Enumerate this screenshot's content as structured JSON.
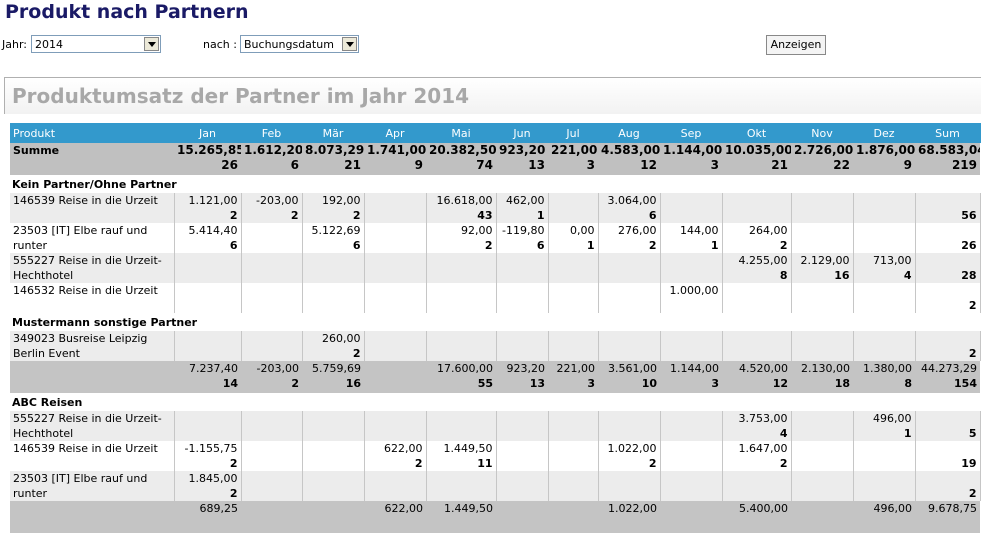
{
  "page": {
    "title": "Produkt nach Partnern"
  },
  "filters": {
    "jahr_label": "Jahr:",
    "jahr_value": "2014",
    "nach_label": "nach :",
    "nach_value": "Buchungsdatum",
    "submit_label": "Anzeigen"
  },
  "report": {
    "title": "Produktumsatz der Partner im Jahr 2014"
  },
  "table": {
    "headers": [
      "Produkt",
      "Jan",
      "Feb",
      "Mär",
      "Apr",
      "Mai",
      "Jun",
      "Jul",
      "Aug",
      "Sep",
      "Okt",
      "Nov",
      "Dez",
      "Sum"
    ],
    "summe": {
      "label": "Summe",
      "values": [
        "15.265,85",
        "1.612,20",
        "8.073,29",
        "1.741,00",
        "20.382,50",
        "923,20",
        "221,00",
        "4.583,00",
        "1.144,00",
        "10.035,00",
        "2.726,00",
        "1.876,00",
        "68.583,04"
      ],
      "counts": [
        "26",
        "6",
        "21",
        "9",
        "74",
        "13",
        "3",
        "12",
        "3",
        "21",
        "22",
        "9",
        "219"
      ]
    },
    "groups": [
      {
        "name": "Kein Partner/Ohne Partner",
        "rows": [
          {
            "product": "146539 Reise in die Urzeit",
            "values": [
              "1.121,00",
              "-203,00",
              "192,00",
              "",
              "16.618,00",
              "462,00",
              "",
              "3.064,00",
              "",
              "",
              "",
              "",
              ""
            ],
            "counts": [
              "2",
              "2",
              "2",
              "",
              "43",
              "1",
              "",
              "6",
              "",
              "",
              "",
              "",
              "56"
            ]
          },
          {
            "product": "23503   [IT] Elbe rauf und runter",
            "values": [
              "5.414,40",
              "",
              "5.122,69",
              "",
              "92,00",
              "-119,80",
              "0,00",
              "276,00",
              "144,00",
              "264,00",
              "",
              "",
              ""
            ],
            "counts": [
              "6",
              "",
              "6",
              "",
              "2",
              "6",
              "1",
              "2",
              "1",
              "2",
              "",
              "",
              "26"
            ]
          },
          {
            "product": "555227 Reise in die Urzeit-Hechthotel",
            "values": [
              "",
              "",
              "",
              "",
              "",
              "",
              "",
              "",
              "",
              "4.255,00",
              "2.129,00",
              "713,00",
              ""
            ],
            "counts": [
              "",
              "",
              "",
              "",
              "",
              "",
              "",
              "",
              "",
              "8",
              "16",
              "4",
              "28"
            ]
          },
          {
            "product": "146532 Reise in die Urzeit",
            "values": [
              "",
              "",
              "",
              "",
              "",
              "",
              "",
              "",
              "1.000,00",
              "",
              "",
              "",
              ""
            ],
            "counts": [
              "",
              "",
              "",
              "",
              "",
              "",
              "",
              "",
              "",
              "",
              "",
              "",
              "2"
            ]
          }
        ]
      },
      {
        "name": "Mustermann sonstige Partner",
        "rows": [
          {
            "product": "349023 Busreise Leipzig Berlin Event",
            "values": [
              "",
              "",
              "260,00",
              "",
              "",
              "",
              "",
              "",
              "",
              "",
              "",
              "",
              ""
            ],
            "counts": [
              "",
              "",
              "2",
              "",
              "",
              "",
              "",
              "",
              "",
              "",
              "",
              "",
              "2"
            ]
          }
        ],
        "subtotal": {
          "values": [
            "7.237,40",
            "-203,00",
            "5.759,69",
            "",
            "17.600,00",
            "923,20",
            "221,00",
            "3.561,00",
            "1.144,00",
            "4.520,00",
            "2.130,00",
            "1.380,00",
            "44.273,29"
          ],
          "counts": [
            "14",
            "2",
            "16",
            "",
            "55",
            "13",
            "3",
            "10",
            "3",
            "12",
            "18",
            "8",
            "154"
          ]
        }
      },
      {
        "name": "ABC Reisen",
        "rows": [
          {
            "product": "555227 Reise in die Urzeit-Hechthotel",
            "values": [
              "",
              "",
              "",
              "",
              "",
              "",
              "",
              "",
              "",
              "3.753,00",
              "",
              "496,00",
              ""
            ],
            "counts": [
              "",
              "",
              "",
              "",
              "",
              "",
              "",
              "",
              "",
              "4",
              "",
              "1",
              "5"
            ]
          },
          {
            "product": "146539 Reise in die Urzeit",
            "values": [
              "-1.155,75",
              "",
              "",
              "622,00",
              "1.449,50",
              "",
              "",
              "1.022,00",
              "",
              "1.647,00",
              "",
              "",
              ""
            ],
            "counts": [
              "2",
              "",
              "",
              "2",
              "11",
              "",
              "",
              "2",
              "",
              "2",
              "",
              "",
              "19"
            ]
          },
          {
            "product": "23503   [IT] Elbe rauf und runter",
            "values": [
              "1.845,00",
              "",
              "",
              "",
              "",
              "",
              "",
              "",
              "",
              "",
              "",
              "",
              ""
            ],
            "counts": [
              "2",
              "",
              "",
              "",
              "",
              "",
              "",
              "",
              "",
              "",
              "",
              "",
              "2"
            ]
          }
        ],
        "subtotal": {
          "values": [
            "689,25",
            "",
            "",
            "622,00",
            "1.449,50",
            "",
            "",
            "1.022,00",
            "",
            "5.400,00",
            "",
            "496,00",
            "9.678,75"
          ],
          "counts": [
            "",
            "",
            "",
            "",
            "",
            "",
            "",
            "",
            "",
            "",
            "",
            "",
            ""
          ]
        }
      }
    ]
  }
}
